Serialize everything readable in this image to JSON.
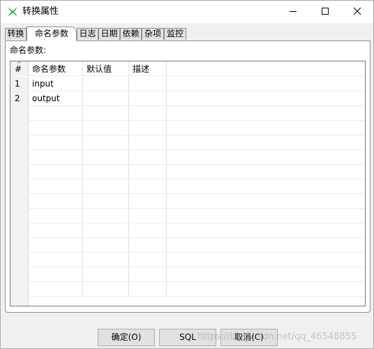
{
  "window": {
    "title": "转换属性",
    "icon": "pentaho-spoon-icon",
    "controls": [
      "minimize-icon",
      "maximize-icon",
      "close-icon"
    ]
  },
  "tabs": [
    {
      "label": "转换",
      "active": false
    },
    {
      "label": "命名参数",
      "active": true
    },
    {
      "label": "日志",
      "active": false
    },
    {
      "label": "日期",
      "active": false
    },
    {
      "label": "依赖",
      "active": false
    },
    {
      "label": "杂项",
      "active": false
    },
    {
      "label": "监控",
      "active": false
    }
  ],
  "panel": {
    "label": "命名参数:"
  },
  "table": {
    "columns": [
      "#",
      "命名参数",
      "默认值",
      "描述"
    ],
    "rows": [
      {
        "num": "1",
        "name": "input",
        "default": "",
        "description": ""
      },
      {
        "num": "2",
        "name": "output",
        "default": "",
        "description": ""
      }
    ]
  },
  "buttons": {
    "ok": "确定(O)",
    "sql": "SQL",
    "cancel": "取消(C)"
  },
  "watermark": "https://blog.csdn.net/qq_46548855",
  "colors": {
    "icon_green": "#2e9e4a",
    "background": "#f0f0f0",
    "panel": "#ffffff"
  }
}
